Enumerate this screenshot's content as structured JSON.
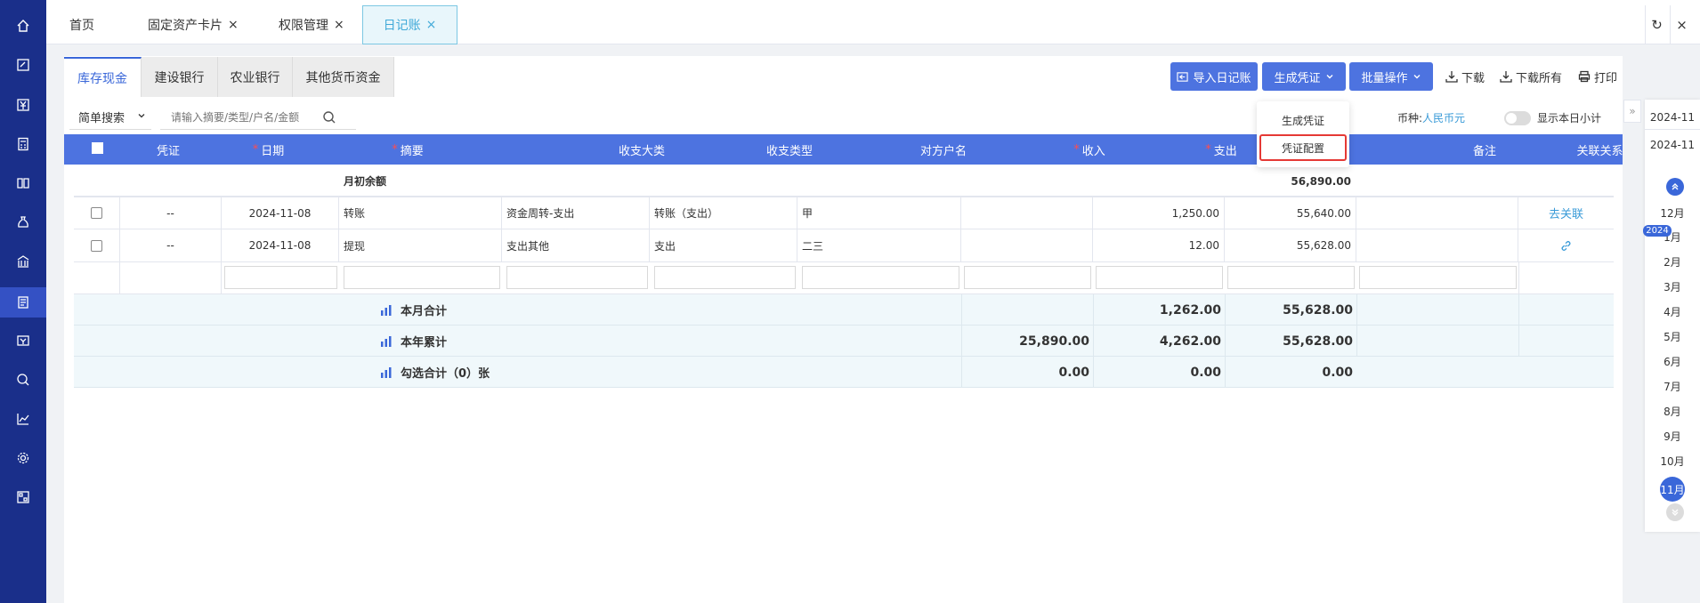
{
  "tabs": [
    {
      "label": "首页"
    },
    {
      "label": "固定资产卡片",
      "close": "×"
    },
    {
      "label": "权限管理",
      "close": "×"
    },
    {
      "label": "日记账",
      "close": "×"
    }
  ],
  "topbar": {
    "refresh_icon": "↻",
    "close_all_icon": "×"
  },
  "subtabs": [
    {
      "label": "库存现金"
    },
    {
      "label": "建设银行"
    },
    {
      "label": "农业银行"
    },
    {
      "label": "其他货币资金"
    }
  ],
  "toolbar": {
    "import_label": "导入日记账",
    "generate_label": "生成凭证",
    "batch_label": "批量操作",
    "download_label": "下载",
    "download_all_label": "下载所有",
    "print_label": "打印"
  },
  "dropdown": {
    "generate": "生成凭证",
    "config": "凭证配置"
  },
  "search": {
    "mode": "简单搜索",
    "placeholder": "请输入摘要/类型/户名/金额"
  },
  "currency": {
    "label": "币种:",
    "value": "人民币元"
  },
  "toggle_label": "显示本日小计",
  "columns": {
    "voucher": "凭证",
    "date": "日期",
    "summary": "摘要",
    "category": "收支大类",
    "type": "收支类型",
    "counterparty": "对方户名",
    "income": "收入",
    "expense": "支出",
    "remark": "备注",
    "relation": "关联关系"
  },
  "opening": {
    "label": "月初余额",
    "balance": "56,890.00"
  },
  "rows": [
    {
      "voucher": "--",
      "date": "2024-11-08",
      "summary": "转账",
      "category": "资金周转-支出",
      "type": "转账（支出）",
      "counterparty": "甲",
      "income": "",
      "expense": "1,250.00",
      "balance": "55,640.00",
      "relation": "去关联"
    },
    {
      "voucher": "--",
      "date": "2024-11-08",
      "summary": "提现",
      "category": "支出其他",
      "type": "支出",
      "counterparty": "二三",
      "income": "",
      "expense": "12.00",
      "balance": "55,628.00",
      "relation": ""
    }
  ],
  "summaries": [
    {
      "label": "本月合计",
      "income": "",
      "expense": "1,262.00",
      "balance": "55,628.00"
    },
    {
      "label": "本年累计",
      "income": "25,890.00",
      "expense": "4,262.00",
      "balance": "55,628.00"
    },
    {
      "label": "勾选合计（0）张",
      "income": "0.00",
      "expense": "0.00",
      "balance": "0.00"
    }
  ],
  "datepanel": {
    "dates": [
      "2024-11",
      "2024-11"
    ],
    "year_badge": "2024",
    "months": [
      "12月",
      "1月",
      "2月",
      "3月",
      "4月",
      "5月",
      "6月",
      "7月",
      "8月",
      "9月",
      "10月",
      "11月"
    ],
    "expand_icon": "»"
  },
  "colors": {
    "sidebar": "#1a2f8a",
    "primary": "#4d73e0",
    "accent": "#3a9bd8",
    "highlight": "#e53935"
  }
}
